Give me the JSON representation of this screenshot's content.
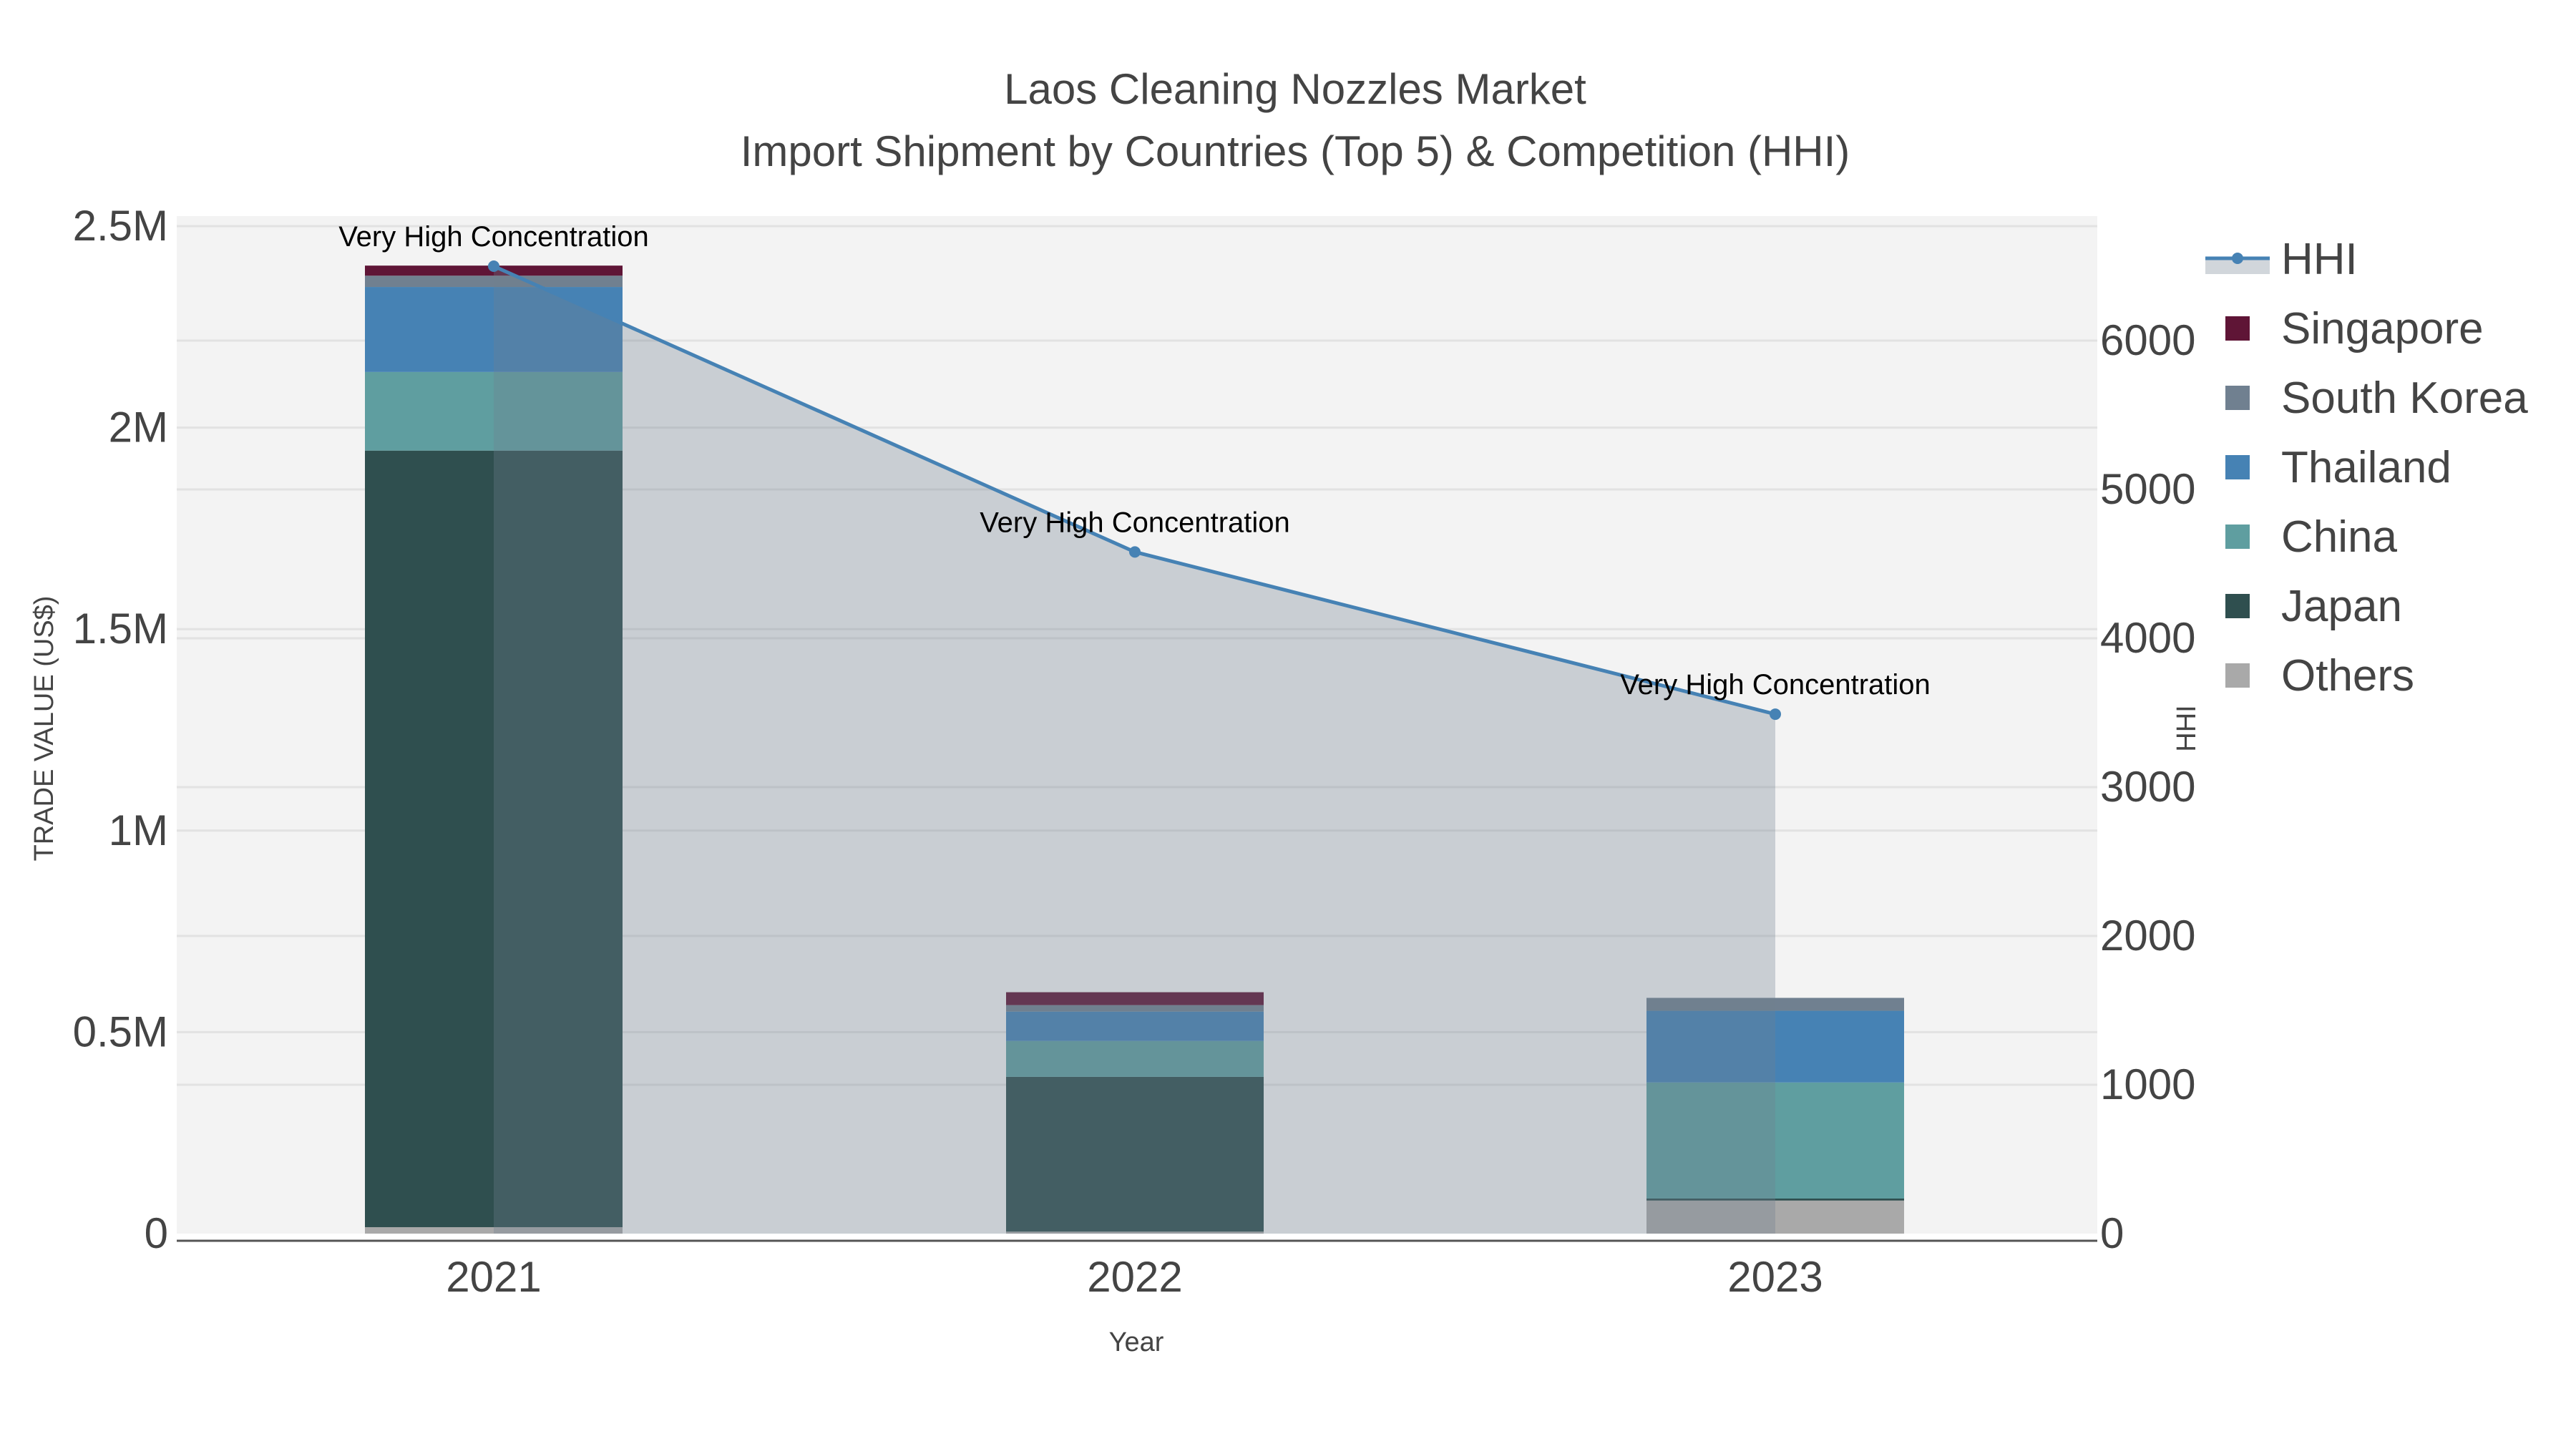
{
  "chart_data": {
    "type": "bar",
    "title": "Laos Cleaning Nozzles Market",
    "subtitle": "Import Shipment by Countries (Top 5) & Competition (HHI)",
    "xlabel": "Year",
    "ylabel": "TRADE VALUE (US$)",
    "y2label": "HHI",
    "categories": [
      "2021",
      "2022",
      "2023"
    ],
    "ylim": [
      0,
      2550000
    ],
    "y2lim": [
      0,
      6850
    ],
    "yticks": [
      0,
      500000,
      1000000,
      1500000,
      2000000,
      2500000
    ],
    "ytick_labels": [
      "0",
      "0.5M",
      "1M",
      "1.5M",
      "2M",
      "2.5M"
    ],
    "y2ticks": [
      0,
      1000,
      2000,
      3000,
      4000,
      5000,
      6000
    ],
    "y2tick_labels": [
      "0",
      "1000",
      "2000",
      "3000",
      "4000",
      "5000",
      "6000"
    ],
    "stacked": true,
    "series": [
      {
        "name": "Others",
        "color": "#a9a9a9",
        "values": [
          16000,
          5000,
          82000
        ]
      },
      {
        "name": "Japan",
        "color": "#2f4f4f",
        "values": [
          1927000,
          384000,
          5000
        ]
      },
      {
        "name": "China",
        "color": "#5f9ea0",
        "values": [
          195000,
          89000,
          288000
        ]
      },
      {
        "name": "Thailand",
        "color": "#4682b4",
        "values": [
          211000,
          73000,
          178000
        ]
      },
      {
        "name": "South Korea",
        "color": "#708090",
        "values": [
          28000,
          16000,
          32000
        ]
      },
      {
        "name": "Singapore",
        "color": "#5f1536",
        "values": [
          25000,
          32000,
          0
        ]
      }
    ],
    "line": {
      "name": "HHI",
      "color": "#4682b4",
      "axis": "right",
      "values": [
        6500,
        4580,
        3490
      ]
    },
    "annotations": [
      "Very High Concentration",
      "Very High Concentration",
      "Very High Concentration"
    ],
    "legend": [
      "HHI",
      "Singapore",
      "South Korea",
      "Thailand",
      "China",
      "Japan",
      "Others"
    ],
    "legend_position": "right",
    "grid": true
  }
}
